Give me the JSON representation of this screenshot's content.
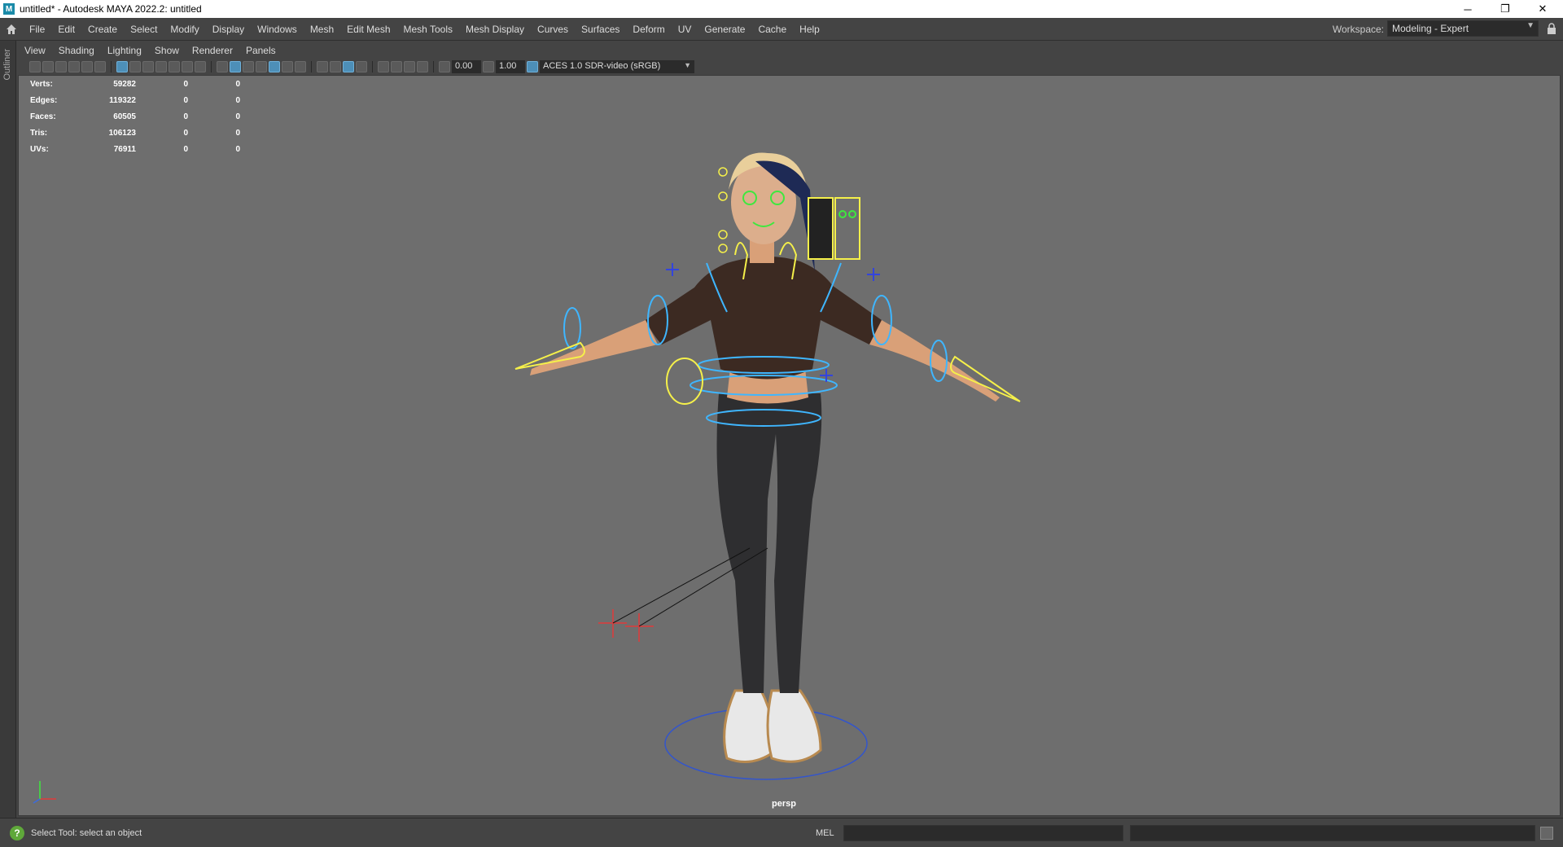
{
  "window": {
    "title": "untitled* - Autodesk MAYA 2022.2: untitled",
    "minimize": "─",
    "maximize": "❐",
    "close": "✕"
  },
  "menubar": {
    "items": [
      "File",
      "Edit",
      "Create",
      "Select",
      "Modify",
      "Display",
      "Windows",
      "Mesh",
      "Edit Mesh",
      "Mesh Tools",
      "Mesh Display",
      "Curves",
      "Surfaces",
      "Deform",
      "UV",
      "Generate",
      "Cache",
      "Help"
    ],
    "workspace_label": "Workspace:",
    "workspace_value": "Modeling - Expert"
  },
  "outliner": {
    "label": "Outliner"
  },
  "viewport_menu": {
    "items": [
      "View",
      "Shading",
      "Lighting",
      "Show",
      "Renderer",
      "Panels"
    ]
  },
  "viewport_toolbar": {
    "exposure": "0.00",
    "gamma": "1.00",
    "color_space": "ACES 1.0 SDR-video (sRGB)"
  },
  "hud": {
    "rows": [
      {
        "label": "Verts:",
        "v1": "59282",
        "v2": "0",
        "v3": "0"
      },
      {
        "label": "Edges:",
        "v1": "119322",
        "v2": "0",
        "v3": "0"
      },
      {
        "label": "Faces:",
        "v1": "60505",
        "v2": "0",
        "v3": "0"
      },
      {
        "label": "Tris:",
        "v1": "106123",
        "v2": "0",
        "v3": "0"
      },
      {
        "label": "UVs:",
        "v1": "76911",
        "v2": "0",
        "v3": "0"
      }
    ]
  },
  "camera": {
    "name": "persp"
  },
  "statusbar": {
    "help_text": "Select Tool: select an object",
    "mel_label": "MEL"
  },
  "colors": {
    "viewport_bg": "#6e6e6e",
    "ui_bg": "#444444",
    "ctrl_blue": "#3fb6ff",
    "ctrl_yellow": "#f5f04a",
    "ctrl_green": "#3ee83e",
    "ctrl_red": "#e03a3a"
  }
}
